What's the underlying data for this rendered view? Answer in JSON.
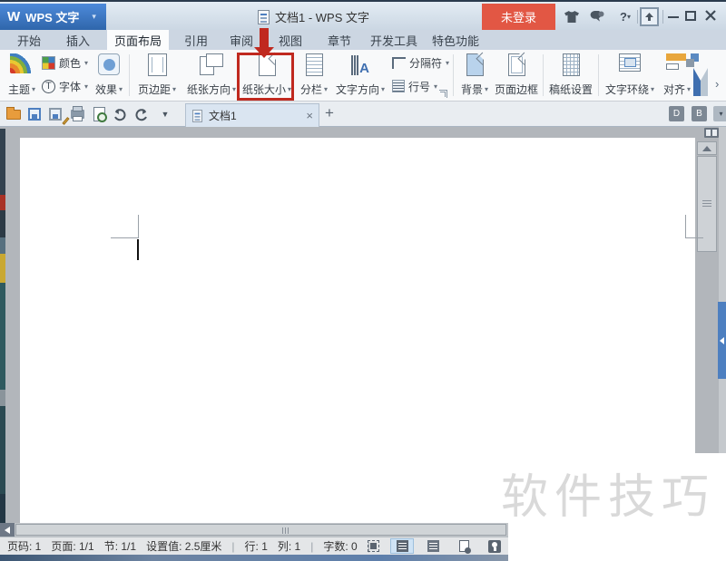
{
  "titlebar": {
    "logo": "W",
    "app_button": "WPS 文字",
    "doc_title": "文档1 - WPS 文字",
    "login_button": "未登录"
  },
  "tabs": [
    {
      "label": "开始",
      "active": false
    },
    {
      "label": "插入",
      "active": false
    },
    {
      "label": "页面布局",
      "active": true
    },
    {
      "label": "引用",
      "active": false
    },
    {
      "label": "审阅",
      "active": false
    },
    {
      "label": "视图",
      "active": false
    },
    {
      "label": "章节",
      "active": false
    },
    {
      "label": "开发工具",
      "active": false
    },
    {
      "label": "特色功能",
      "active": false
    }
  ],
  "ribbon": {
    "theme": "主题",
    "colors": "颜色",
    "fonts": "字体",
    "effects": "效果",
    "margins": "页边距",
    "orientation": "纸张方向",
    "paper_size": "纸张大小",
    "columns": "分栏",
    "text_direction": "文字方向",
    "breaks": "分隔符",
    "line_numbers": "行号",
    "background": "背景",
    "page_border": "页面边框",
    "grid_paper": "稿纸设置",
    "text_wrap": "文字环绕",
    "align": "对齐"
  },
  "document_tab": {
    "label": "文档1"
  },
  "statusbar": {
    "page_no": "页码: 1",
    "pages": "页面: 1/1",
    "section": "节: 1/1",
    "setting": "设置值: 2.5厘米",
    "line": "行: 1",
    "column": "列: 1",
    "words": "字数: 0",
    "divider": "|"
  },
  "watermark": "软件技巧",
  "glyphs": {
    "dropdown": "▾",
    "dropdown_big": "▼",
    "close": "×",
    "plus": "+",
    "help": "?",
    "chevron": "›",
    "fontT": "T",
    "textdir_a": "A",
    "mini_d": "D",
    "mini_b": "B"
  },
  "colors": {
    "highlight_red": "#c0291f",
    "login_orange": "#e25744",
    "wps_blue": "#3b74c2",
    "side_tab_blue": "#4d7fc0"
  }
}
